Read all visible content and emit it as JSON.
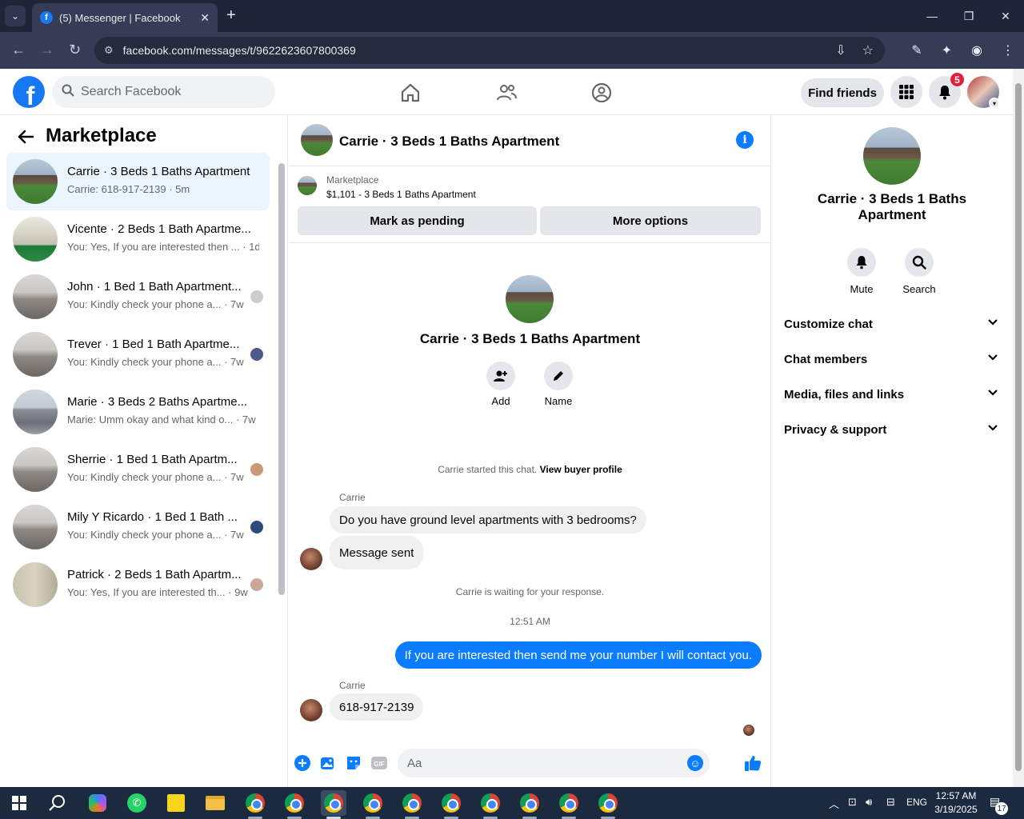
{
  "browser": {
    "tab_title": "(5) Messenger | Facebook",
    "url": "facebook.com/messages/t/9622623607800369"
  },
  "fb": {
    "search_placeholder": "Search Facebook",
    "find_friends": "Find friends",
    "notification_count": "5"
  },
  "left": {
    "title": "Marketplace",
    "conversations": [
      {
        "name": "Carrie · 3 Beds 1 Baths Apartment",
        "preview": "Carrie: 618-917-2139 · 5m",
        "active": true
      },
      {
        "name": "Vicente · 2 Beds 1 Bath Apartme...",
        "preview": "You: Yes, If you are interested then ... · 1d"
      },
      {
        "name": "John · 1 Bed 1 Bath Apartment...",
        "preview": "You: Kindly check your phone a... · 7w"
      },
      {
        "name": "Trever · 1 Bed 1 Bath Apartme...",
        "preview": "You: Kindly check your phone a... · 7w"
      },
      {
        "name": "Marie · 3 Beds 2 Baths Apartme...",
        "preview": "Marie: Umm okay and what kind o... · 7w"
      },
      {
        "name": "Sherrie · 1 Bed 1 Bath Apartm...",
        "preview": "You: Kindly check your phone a... · 7w"
      },
      {
        "name": "Mily Y Ricardo · 1 Bed 1 Bath ...",
        "preview": "You: Kindly check your phone a... · 7w"
      },
      {
        "name": "Patrick · 2 Beds 1 Bath Apartm...",
        "preview": "You: Yes, If you are interested th... · 9w"
      }
    ]
  },
  "chat": {
    "header_name": "Carrie · 3 Beds 1 Baths Apartment",
    "marketplace_label": "Marketplace",
    "listing": "$1,101 - 3 Beds 1 Baths Apartment",
    "mark_pending": "Mark as pending",
    "more_options": "More options",
    "intro_name": "Carrie · 3 Beds 1 Baths Apartment",
    "add_label": "Add",
    "name_label": "Name",
    "started_text": "Carrie started this chat.",
    "view_profile": "View buyer profile",
    "sender1": "Carrie",
    "msg1": "Do you have ground level apartments with 3 bedrooms?",
    "msg2": "Message sent",
    "waiting": "Carrie is waiting for your response.",
    "time": "12:51 AM",
    "msg3": "If you are interested then send me your number I will contact you.",
    "sender2": "Carrie",
    "msg4": "618-917-2139",
    "composer_placeholder": "Aa"
  },
  "right": {
    "name": "Carrie · 3 Beds 1 Baths Apartment",
    "mute": "Mute",
    "search": "Search",
    "rows": [
      "Customize chat",
      "Chat members",
      "Media, files and links",
      "Privacy & support"
    ]
  },
  "taskbar": {
    "lang": "ENG",
    "time": "12:57 AM",
    "date": "3/19/2025",
    "notif": "17"
  }
}
